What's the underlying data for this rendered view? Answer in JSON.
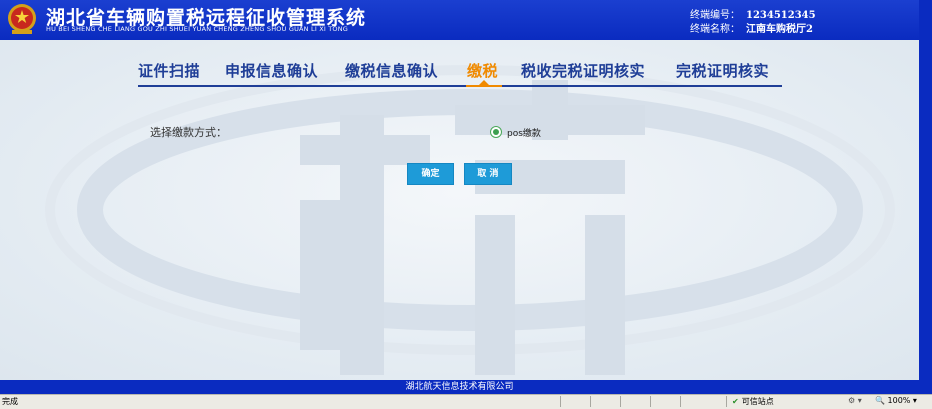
{
  "header": {
    "title": "湖北省车辆购置税远程征收管理系统",
    "pinyin": "HU BEI SHENG CHE LIANG GOU ZHI SHUEI YUAN CHENG ZHENG SHOU GUAN LI XI TONG",
    "terminal_no_label": "终端编号：",
    "terminal_no": "1234512345",
    "terminal_name_label": "终端名称：",
    "terminal_name": "江南车购税厅2"
  },
  "tabs": [
    {
      "label": "证件扫描",
      "active": false
    },
    {
      "label": "申报信息确认",
      "active": false
    },
    {
      "label": "缴税信息确认",
      "active": false
    },
    {
      "label": "缴税",
      "active": true
    },
    {
      "label": "税收完税证明核实",
      "active": false
    },
    {
      "label": "完税证明核实",
      "active": false
    }
  ],
  "payment": {
    "label": "选择缴款方式：",
    "option": "pos缴款",
    "selected": true
  },
  "buttons": {
    "confirm": "确定",
    "cancel": "取 消"
  },
  "footer": {
    "company": "湖北航天信息技术有限公司"
  },
  "statusbar": {
    "status": "完成",
    "zone": "可信站点",
    "zoom": "100%"
  },
  "colors": {
    "header_blue": "#0a2bc0",
    "tab_text": "#1f3e97",
    "tab_active": "#f08a00",
    "button": "#1e9bd8"
  }
}
